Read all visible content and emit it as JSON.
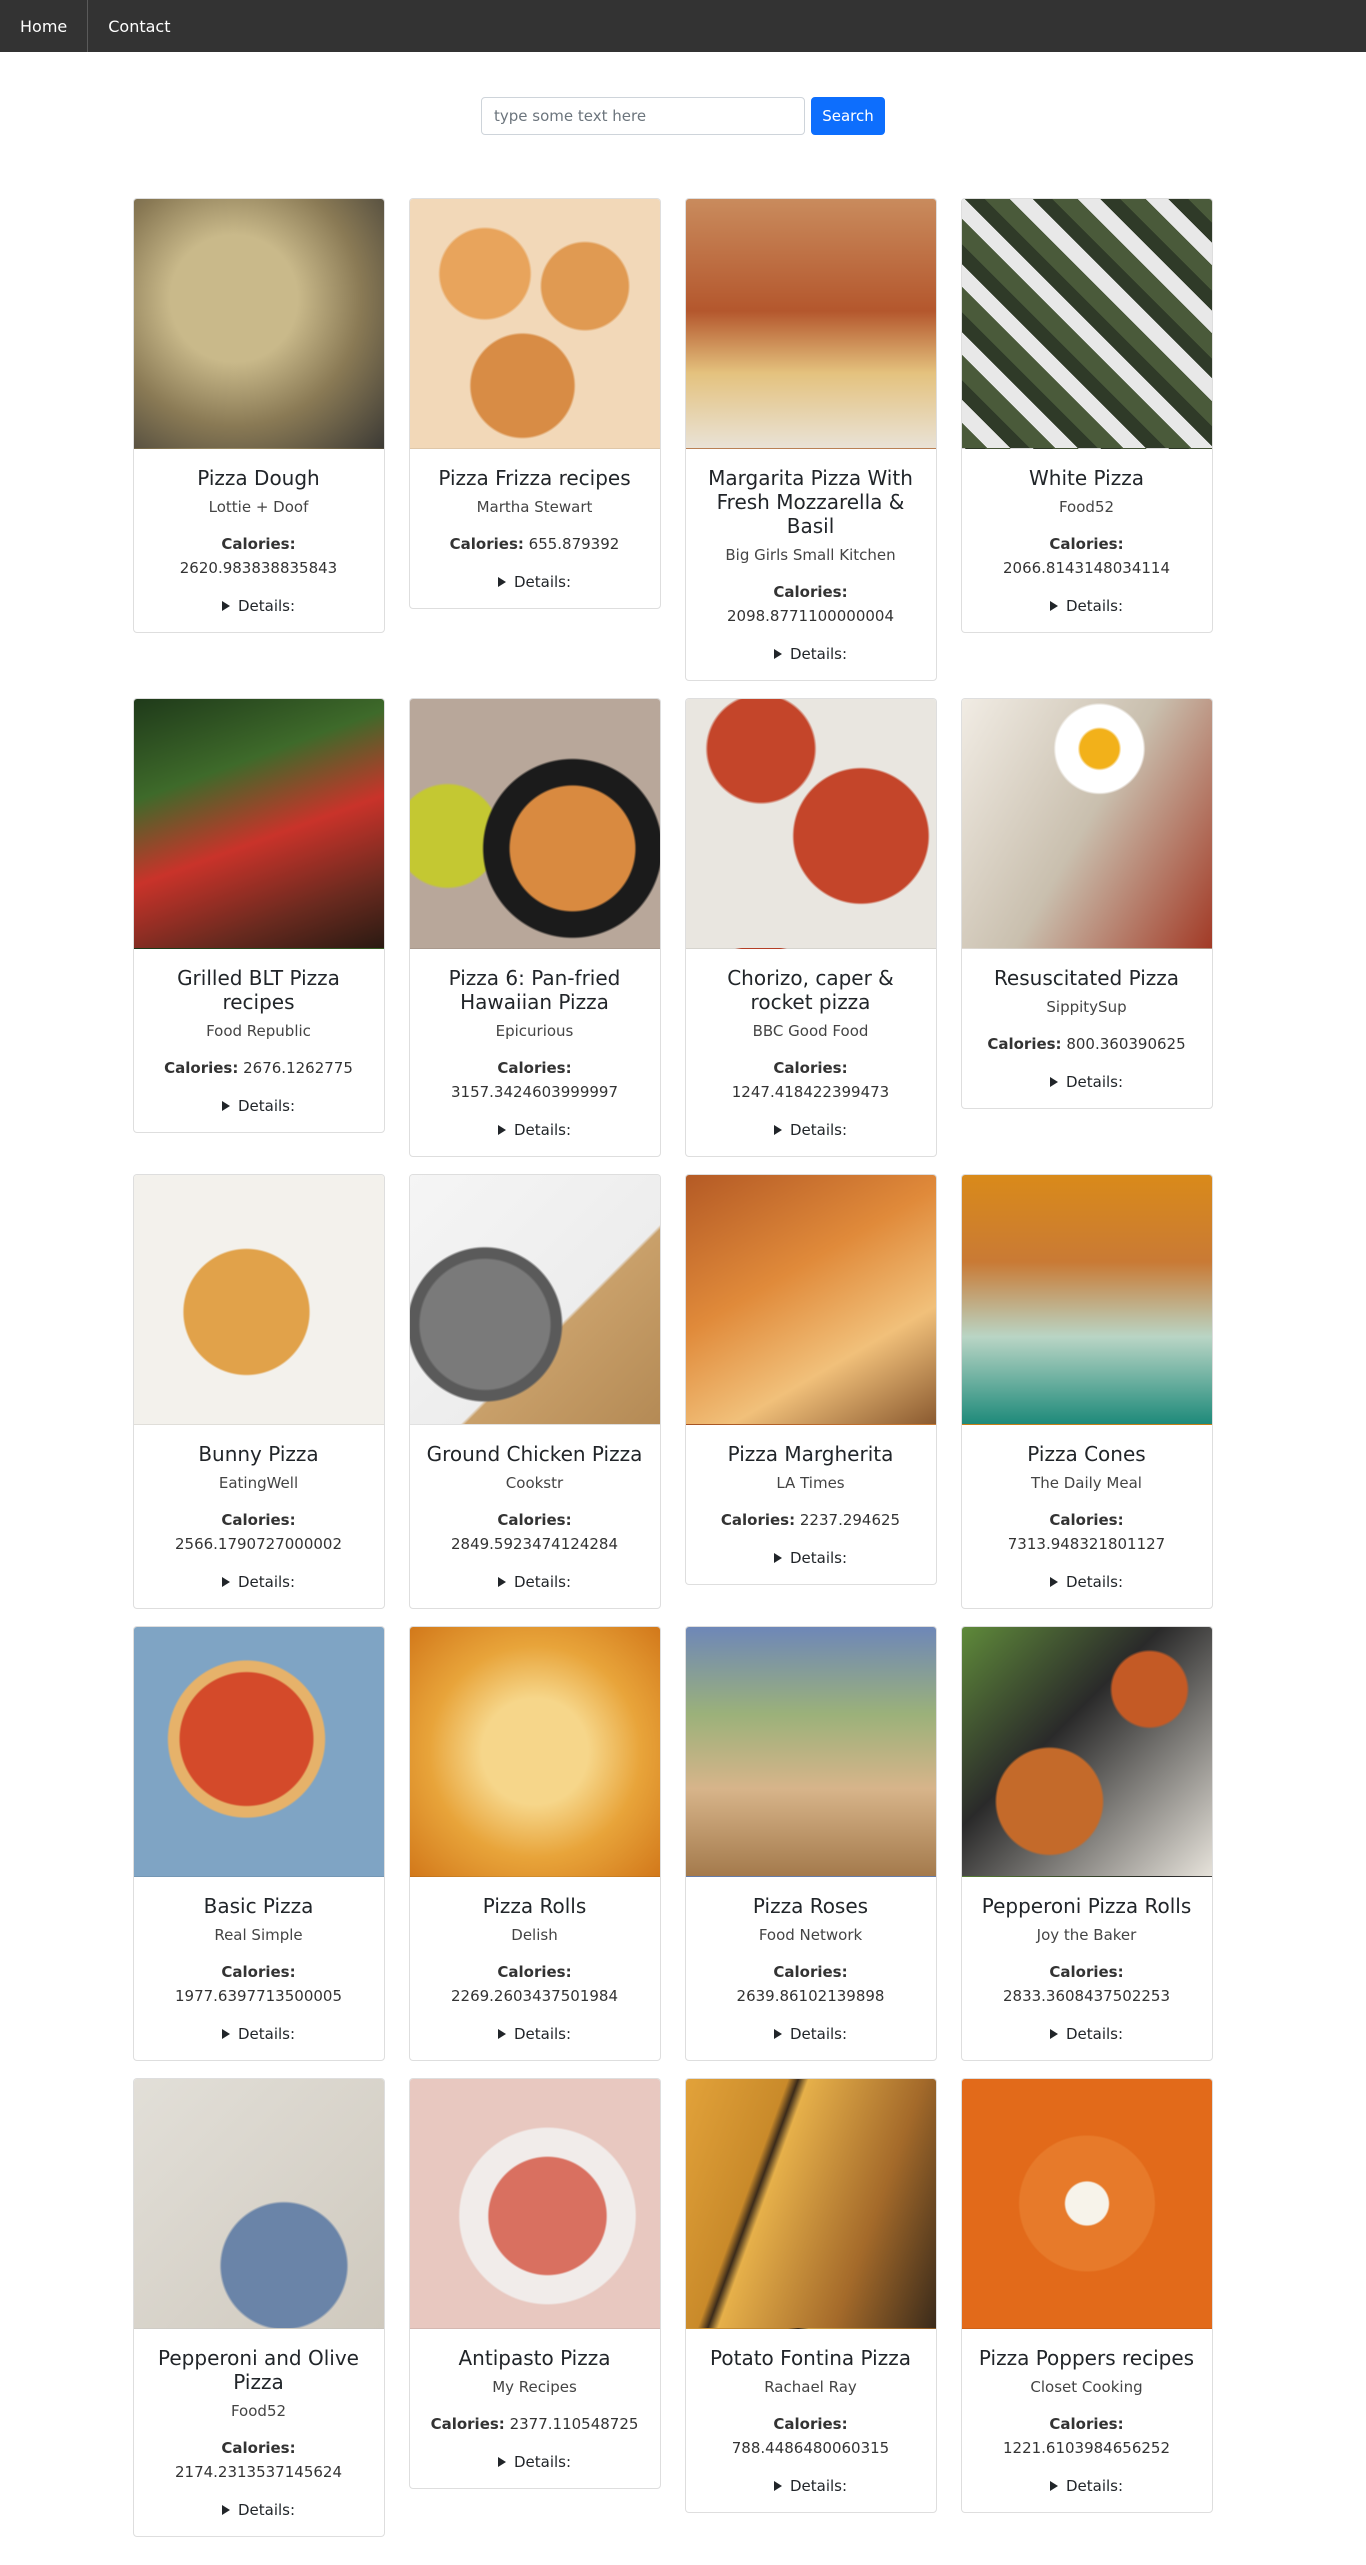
{
  "nav": {
    "home": "Home",
    "contact": "Contact"
  },
  "search": {
    "placeholder": "type some text here",
    "button": "Search"
  },
  "labels": {
    "calories": "Calories:",
    "details": "Details:"
  },
  "recipes": [
    {
      "title": "Pizza Dough",
      "source": "Lottie + Doof",
      "calories": "2620.983838835843"
    },
    {
      "title": "Pizza Frizza recipes",
      "source": "Martha Stewart",
      "calories": "655.879392"
    },
    {
      "title": "Margarita Pizza With Fresh Mozzarella & Basil",
      "source": "Big Girls Small Kitchen",
      "calories": "2098.8771100000004"
    },
    {
      "title": "White Pizza",
      "source": "Food52",
      "calories": "2066.8143148034114"
    },
    {
      "title": "Grilled BLT Pizza recipes",
      "source": "Food Republic",
      "calories": "2676.1262775"
    },
    {
      "title": "Pizza 6: Pan-fried Hawaiian Pizza",
      "source": "Epicurious",
      "calories": "3157.3424603999997"
    },
    {
      "title": "Chorizo, caper & rocket pizza",
      "source": "BBC Good Food",
      "calories": "1247.418422399473"
    },
    {
      "title": "Resuscitated Pizza",
      "source": "SippitySup",
      "calories": "800.360390625"
    },
    {
      "title": "Bunny Pizza",
      "source": "EatingWell",
      "calories": "2566.1790727000002"
    },
    {
      "title": "Ground Chicken Pizza",
      "source": "Cookstr",
      "calories": "2849.5923474124284"
    },
    {
      "title": "Pizza Margherita",
      "source": "LA Times",
      "calories": "2237.294625"
    },
    {
      "title": "Pizza Cones",
      "source": "The Daily Meal",
      "calories": "7313.948321801127"
    },
    {
      "title": "Basic Pizza",
      "source": "Real Simple",
      "calories": "1977.6397713500005"
    },
    {
      "title": "Pizza Rolls",
      "source": "Delish",
      "calories": "2269.2603437501984"
    },
    {
      "title": "Pizza Roses",
      "source": "Food Network",
      "calories": "2639.86102139898"
    },
    {
      "title": "Pepperoni Pizza Rolls",
      "source": "Joy the Baker",
      "calories": "2833.3608437502253"
    },
    {
      "title": "Pepperoni and Olive Pizza",
      "source": "Food52",
      "calories": "2174.2313537145624"
    },
    {
      "title": "Antipasto Pizza",
      "source": "My Recipes",
      "calories": "2377.110548725"
    },
    {
      "title": "Potato Fontina Pizza",
      "source": "Rachael Ray",
      "calories": "788.4486480060315"
    },
    {
      "title": "Pizza Poppers recipes",
      "source": "Closet Cooking",
      "calories": "1221.6103984656252"
    }
  ]
}
